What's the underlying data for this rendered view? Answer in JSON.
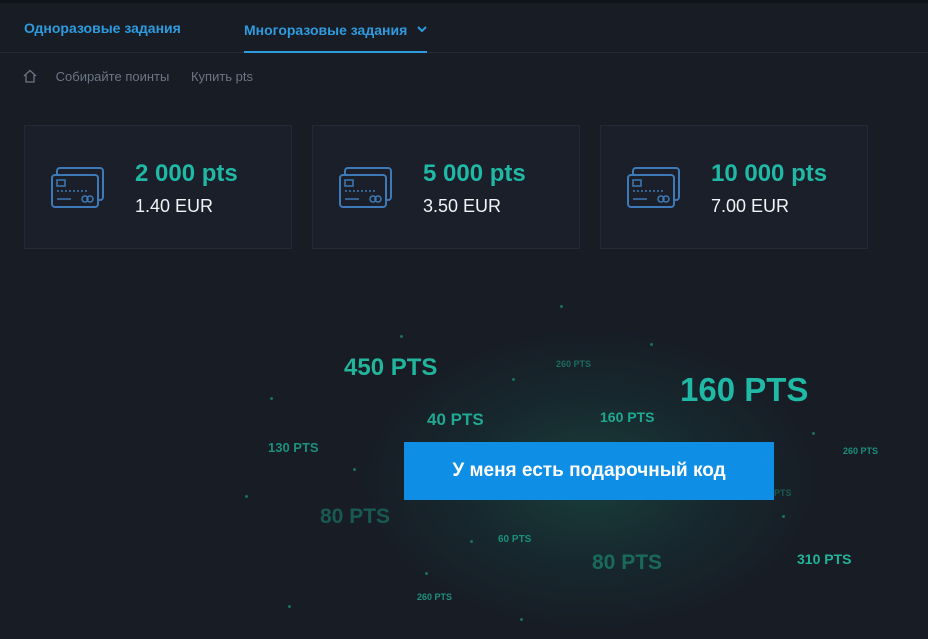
{
  "tabs": [
    {
      "label": "Одноразовые задания"
    },
    {
      "label": "Многоразовые задания"
    }
  ],
  "breadcrumbs": {
    "home_icon": "home-icon",
    "items": [
      "Собирайте поинты",
      "Купить pts"
    ]
  },
  "packages": [
    {
      "points": "2 000 pts",
      "price": "1.40 EUR",
      "icon": "credit-cards-icon"
    },
    {
      "points": "5 000 pts",
      "price": "3.50 EUR",
      "icon": "credit-cards-icon"
    },
    {
      "points": "10 000 pts",
      "price": "7.00 EUR",
      "icon": "credit-cards-icon"
    }
  ],
  "floating_labels": [
    "450 PTS",
    "260 PTS",
    "160 PTS",
    "40 PTS",
    "160 PTS",
    "130 PTS",
    "260 PTS",
    "80 PTS",
    "PTS",
    "60 PTS",
    "80 PTS",
    "310 PTS",
    "260 PTS"
  ],
  "gift_button_label": "У меня есть подарочный код",
  "colors": {
    "background": "#171c25",
    "accent_blue": "#2f9bde",
    "accent_teal": "#1fb9a5",
    "button": "#0e8ee4"
  }
}
